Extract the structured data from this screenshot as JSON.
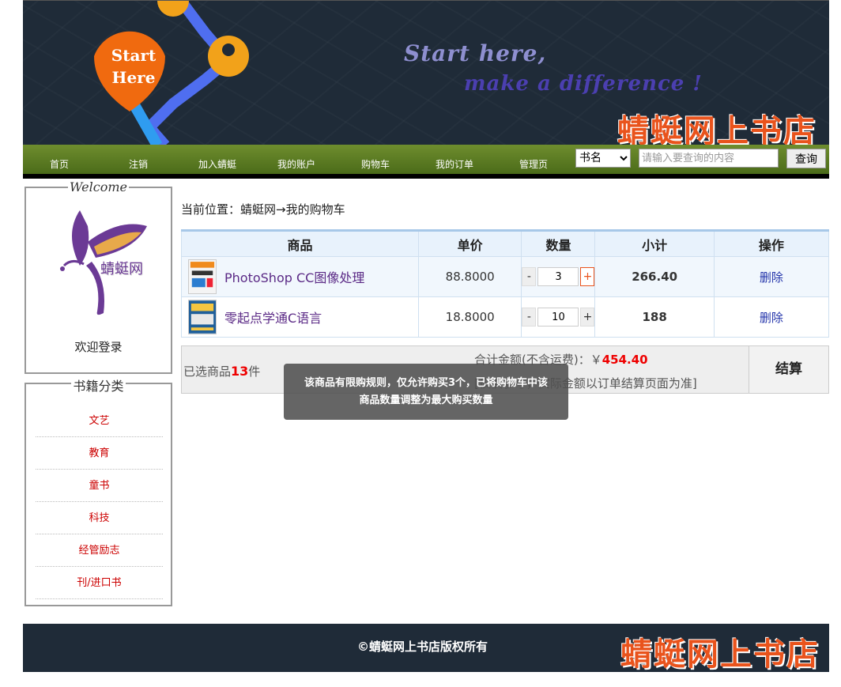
{
  "banner": {
    "pin_text_line1": "Start",
    "pin_text_line2": "Here",
    "tagline1": "Start here,",
    "tagline2": "make a difference !",
    "brand": "蜻蜓网上书店"
  },
  "nav": {
    "items": [
      "首页",
      "注销",
      "加入蜻蜓",
      "我的账户",
      "购物车",
      "我的订单",
      "管理页"
    ],
    "search_type": "书名",
    "search_placeholder": "请输入要查询的内容",
    "search_button": "查询"
  },
  "sidebar": {
    "welcome_legend": "Welcome",
    "logo_text": "蜻蜓网",
    "greeting": "欢迎登录",
    "categories_legend": "书籍分类",
    "categories": [
      "文艺",
      "教育",
      "童书",
      "科技",
      "经管励志",
      "刊/进口书"
    ]
  },
  "breadcrumb": "当前位置：蜻蜓网→我的购物车",
  "cart": {
    "headers": [
      "商品",
      "单价",
      "数量",
      "小计",
      "操作"
    ],
    "rows": [
      {
        "name": "PhotoShop CC图像处理",
        "price": "88.8000",
        "qty": "3",
        "subtotal": "266.40",
        "action": "删除"
      },
      {
        "name": "零起点学通C语言",
        "price": "18.8000",
        "qty": "10",
        "subtotal": "188",
        "action": "删除"
      }
    ],
    "minus": "-",
    "plus": "+"
  },
  "summary": {
    "selected_prefix": "已选商品",
    "selected_count": "13",
    "selected_suffix": "件",
    "total_label": "合计金额(不含运费)：￥",
    "total_value": "454.40",
    "note": "[仅供参考，实际金额以订单结算页面为准]",
    "checkout": "结算"
  },
  "toast": "该商品有限购规则，仅允许购买3个，已将购物车中该商品数量调整为最大购买数量",
  "footer": {
    "copyright": "©蜻蜓网上书店版权所有",
    "brand": "蜻蜓网上书店"
  },
  "colors": {
    "nav_green": "#5a7a22",
    "brand_orange": "#e9531c",
    "price_red": "#e00000"
  }
}
